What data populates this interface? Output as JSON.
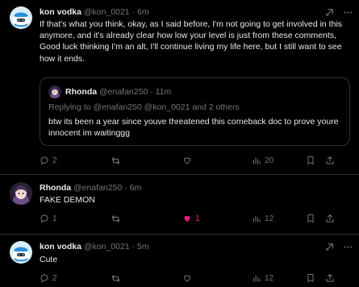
{
  "posts": [
    {
      "name": "kon vodka",
      "handle": "@kon_0021",
      "time": "6m",
      "text": "If that's what you think, okay, as I said before, I'm not going to get involved in this anymore, and it's already clear how low your level is just from these comments, Good luck thinking I'm an alt, I'll continue living my life here, but I still want to see how it ends.",
      "replies": "2",
      "reposts": "",
      "likes": "",
      "views": "20",
      "quote": {
        "name": "Rhonda",
        "handle": "@enafan250",
        "time": "11m",
        "replying_to": "Replying to @enafan250 @kon_0021 and 2 others",
        "text": "btw its been a year since youve threatened this comeback doc to prove youre innocent im waitinggg"
      }
    },
    {
      "name": "Rhonda",
      "handle": "@enafan250",
      "time": "6m",
      "text": "FAKE DEMON",
      "replies": "1",
      "reposts": "",
      "likes": "1",
      "views": "12"
    },
    {
      "name": "kon vodka",
      "handle": "@kon_0021",
      "time": "5m",
      "text": "Cute",
      "replies": "2",
      "reposts": "",
      "likes": "",
      "views": "12"
    }
  ],
  "colors": {
    "background": "#000000",
    "muted": "#71767b",
    "like": "#f91880",
    "border": "#2f3336"
  },
  "icons": [
    "grok-icon",
    "more-icon",
    "reply-icon",
    "repost-icon",
    "like-icon",
    "views-icon",
    "bookmark-icon",
    "share-icon"
  ]
}
